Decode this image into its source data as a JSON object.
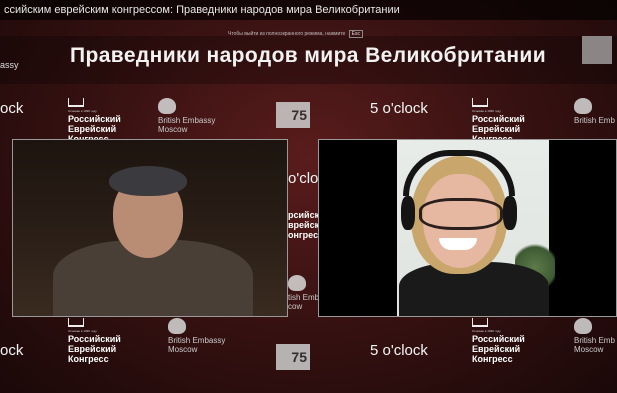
{
  "header": {
    "video_title": "ссийским еврейским конгрессом: Праведники народов мира Великобритании",
    "fullscreen_hint": "Чтобы выйти из полноэкранного режима, нажмите",
    "fullscreen_key": "Esc",
    "left_edge_text": "assy"
  },
  "banner": {
    "title": "Праведники народов мира Великобритании"
  },
  "backdrop": {
    "brand": "5 o'clock",
    "brand_cut": "o'clo",
    "brand_edge": "ock",
    "rjc_small": "Основан в 1996 году",
    "rjc_line1": "Российский",
    "rjc_line2": "Еврейский",
    "rjc_line3": "Конгресс",
    "rjc_cut1": "рсийск",
    "rjc_cut2": "врейск",
    "rjc_cut3": "онгресс",
    "embassy_line1": "British Embassy",
    "embassy_line2": "Moscow",
    "embassy_cut1": "tish Emba",
    "embassy_cut2": "cow",
    "embassy_cut_right": "British Emb",
    "badge_number": "75"
  },
  "participants": {
    "left_name": "",
    "right_name": ""
  },
  "colors": {
    "backdrop": "#3a1212",
    "text": "#f2f2f2"
  }
}
